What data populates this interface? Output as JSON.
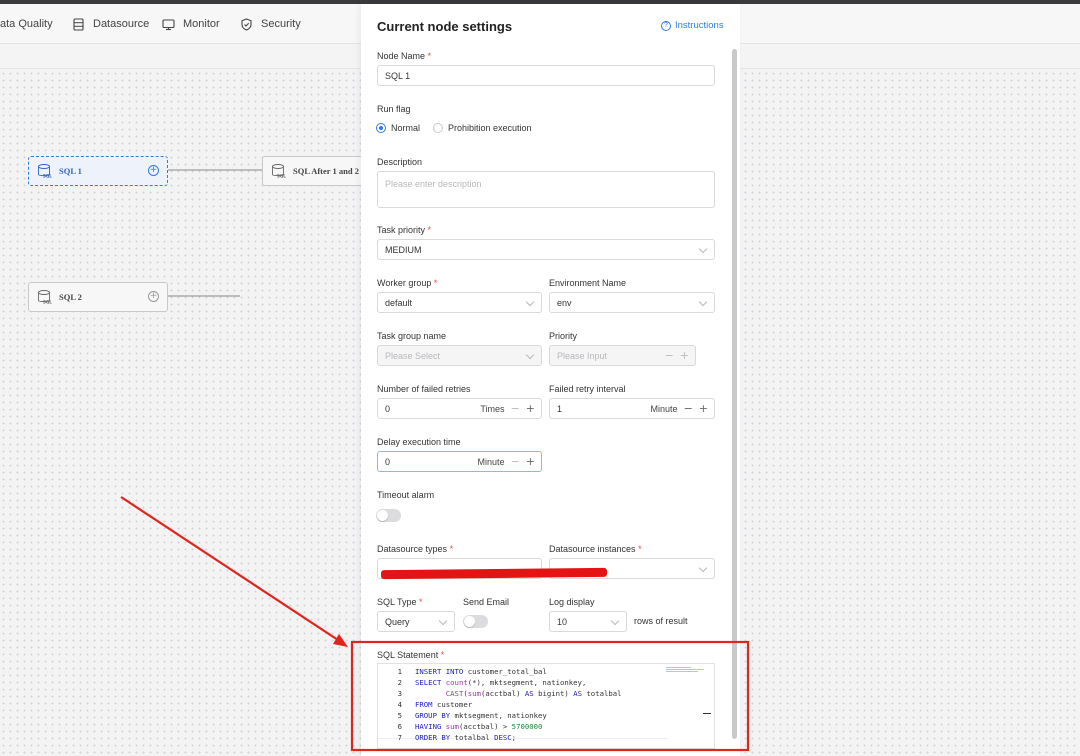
{
  "navbar": {
    "items": [
      {
        "label": "ata Quality",
        "icon": "data-quality-icon"
      },
      {
        "label": "Datasource",
        "icon": "datasource-icon"
      },
      {
        "label": "Monitor",
        "icon": "monitor-icon"
      },
      {
        "label": "Security",
        "icon": "security-icon"
      }
    ]
  },
  "canvas": {
    "nodes": [
      {
        "label": "SQL 1",
        "state": "selected"
      },
      {
        "label": "SQL After 1 and 2",
        "state": "normal"
      },
      {
        "label": "SQL 2",
        "state": "normal"
      }
    ],
    "node_icon_text": "SQL"
  },
  "drawer": {
    "title": "Current node settings",
    "instructions": "Instructions",
    "node_name": {
      "label": "Node Name",
      "required_mark": "*",
      "value": "SQL 1"
    },
    "run_flag": {
      "label": "Run flag",
      "options": [
        "Normal",
        "Prohibition execution"
      ],
      "selected": "Normal"
    },
    "description": {
      "label": "Description",
      "placeholder": "Please enter description"
    },
    "task_priority": {
      "label": "Task priority",
      "required_mark": "*",
      "value": "MEDIUM"
    },
    "worker_group": {
      "label": "Worker group",
      "required_mark": "*",
      "value": "default"
    },
    "environment_name": {
      "label": "Environment Name",
      "value": "env"
    },
    "task_group_name": {
      "label": "Task group name",
      "placeholder": "Please Select"
    },
    "priority": {
      "label": "Priority",
      "placeholder": "Please Input"
    },
    "failed_retries": {
      "label": "Number of failed retries",
      "value": "0",
      "unit": "Times"
    },
    "retry_interval": {
      "label": "Failed retry interval",
      "value": "1",
      "unit": "Minute"
    },
    "delay_time": {
      "label": "Delay execution time",
      "value": "0",
      "unit": "Minute"
    },
    "timeout_alarm": {
      "label": "Timeout alarm",
      "enabled": false
    },
    "datasource_types": {
      "label": "Datasource types",
      "required_mark": "*"
    },
    "datasource_instances": {
      "label": "Datasource instances",
      "required_mark": "*"
    },
    "sql_type": {
      "label": "SQL Type",
      "required_mark": "*",
      "value": "Query"
    },
    "send_email": {
      "label": "Send Email",
      "enabled": false
    },
    "log_display": {
      "label": "Log display",
      "value": "10",
      "suffix": "rows of result"
    },
    "sql_statement": {
      "label": "SQL Statement",
      "required_mark": "*"
    },
    "stepper_minus": "−",
    "stepper_plus": "+"
  },
  "colors": {
    "accent": "#2f7de1",
    "required": "#e0503e",
    "annotation": "#e0251b",
    "redaction": "#e41414"
  }
}
